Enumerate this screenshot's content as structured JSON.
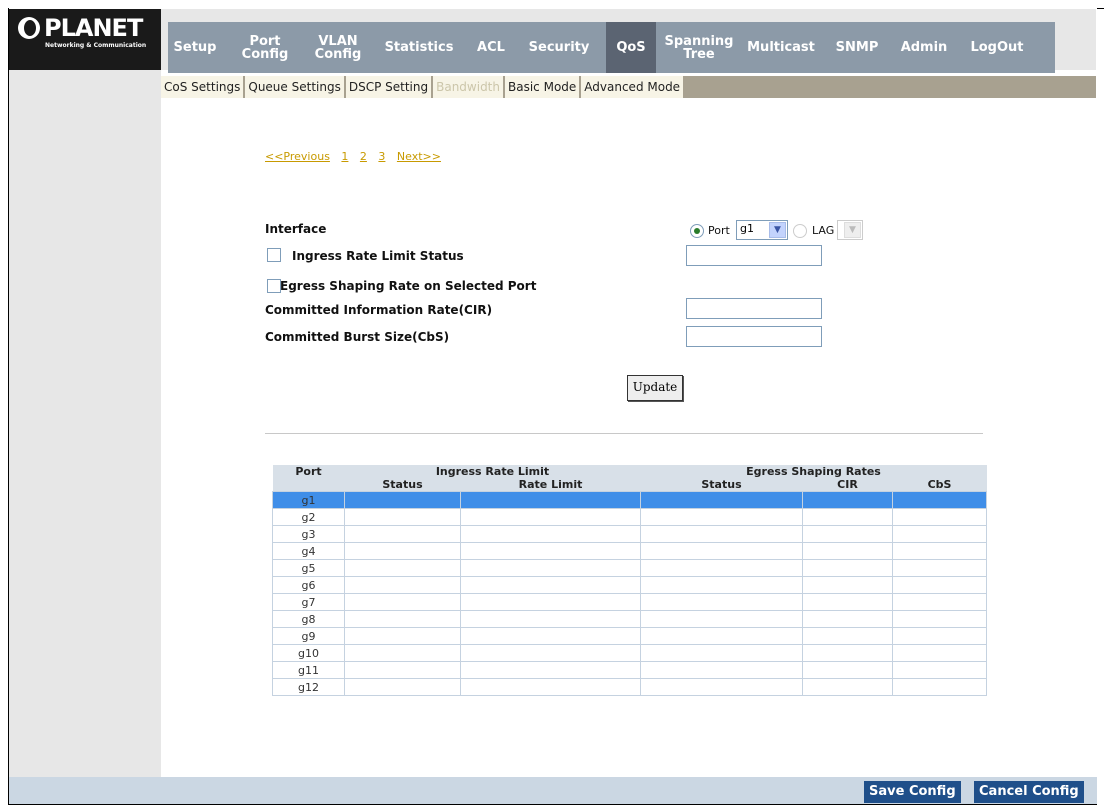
{
  "brand": {
    "name": "PLANET",
    "tagline": "Networking & Communication"
  },
  "nav": {
    "items": [
      {
        "label": "Setup",
        "id": "setup"
      },
      {
        "label": "Port\nConfig",
        "id": "port-config"
      },
      {
        "label": "VLAN\nConfig",
        "id": "vlan-config"
      },
      {
        "label": "Statistics",
        "id": "statistics"
      },
      {
        "label": "ACL",
        "id": "acl"
      },
      {
        "label": "Security",
        "id": "security"
      },
      {
        "label": "QoS",
        "id": "qos",
        "active": true
      },
      {
        "label": "Spanning\nTree",
        "id": "spanning-tree"
      },
      {
        "label": "Multicast",
        "id": "multicast"
      },
      {
        "label": "SNMP",
        "id": "snmp"
      },
      {
        "label": "Admin",
        "id": "admin"
      },
      {
        "label": "LogOut",
        "id": "logout"
      }
    ]
  },
  "subnav": {
    "items": [
      {
        "label": "CoS Settings"
      },
      {
        "label": "Queue Settings"
      },
      {
        "label": "DSCP Setting"
      },
      {
        "label": "Bandwidth",
        "active": true
      },
      {
        "label": "Basic Mode"
      },
      {
        "label": "Advanced Mode"
      }
    ]
  },
  "pager": {
    "previous": "<<Previous",
    "pages": [
      "1",
      "2",
      "3"
    ],
    "next": "Next>>"
  },
  "form": {
    "interface_label": "Interface",
    "port_label": "Port",
    "port_value": "g1",
    "lag_label": "LAG",
    "lag_value": "",
    "ingress_label": "Ingress Rate Limit Status",
    "egress_label": "Egress Shaping Rate on Selected Port",
    "cir_label": "Committed Information Rate(CIR)",
    "cbs_label": "Committed Burst Size(CbS)",
    "update_label": "Update"
  },
  "table": {
    "group_headers": {
      "port": "Port",
      "ingress": "Ingress Rate Limit",
      "egress": "Egress Shaping Rates"
    },
    "sub_headers": {
      "status": "Status",
      "rate_limit": "Rate Limit",
      "egress_status": "Status",
      "cir": "CIR",
      "cbs": "CbS"
    },
    "rows": [
      "g1",
      "g2",
      "g3",
      "g4",
      "g5",
      "g6",
      "g7",
      "g8",
      "g9",
      "g10",
      "g11",
      "g12"
    ]
  },
  "footer": {
    "save": "Save Config",
    "cancel": "Cancel Config"
  },
  "colors": {
    "nav_bg": "#8c9aa8",
    "nav_active": "#5b6472",
    "selected_row": "#3f8ee8",
    "footer_btn": "#1f4f8a"
  }
}
